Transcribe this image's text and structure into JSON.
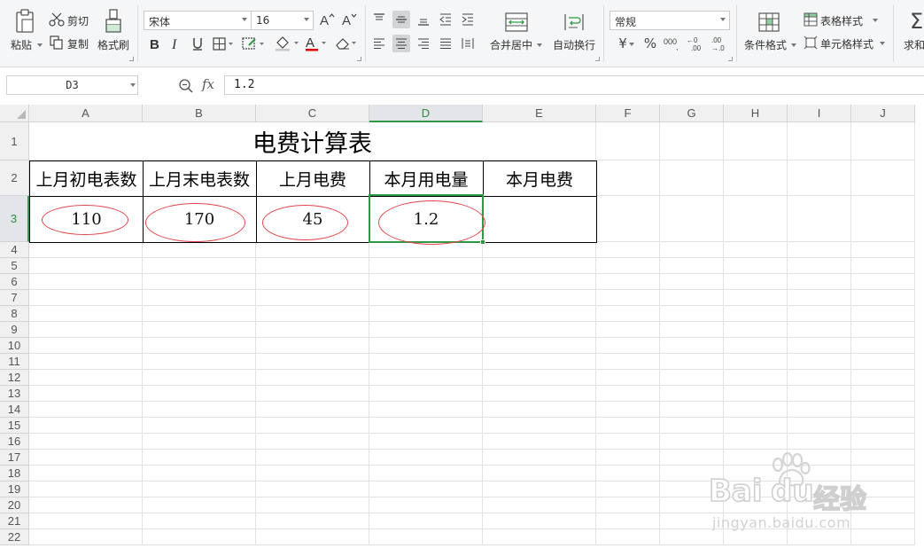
{
  "ribbon": {
    "clipboard": {
      "paste_label": "粘贴",
      "cut_label": "剪切",
      "copy_label": "复制",
      "format_painter_label": "格式刷"
    },
    "font": {
      "name": "宋体",
      "size": "16",
      "font_color": "#e0000b"
    },
    "alignment": {
      "merge_center_label": "合并居中",
      "wrap_text_label": "自动换行"
    },
    "number": {
      "format": "常规",
      "currency_symbol": "¥",
      "percent_symbol": "%"
    },
    "styles": {
      "conditional_format_label": "条件格式",
      "table_style_label": "表格样式",
      "cell_style_label": "单元格样式",
      "sum_label": "求和"
    }
  },
  "formula_bar": {
    "name_box": "D3",
    "fx_label": "fx",
    "content": "1.2"
  },
  "grid": {
    "columns": [
      "A",
      "B",
      "C",
      "D",
      "E",
      "F",
      "G",
      "H",
      "I",
      "J"
    ],
    "selected_column": "D",
    "row_numbers": [
      "1",
      "2",
      "3",
      "4",
      "5",
      "6",
      "7",
      "8",
      "9",
      "10",
      "11",
      "12",
      "13",
      "14",
      "15",
      "16",
      "17",
      "18",
      "19",
      "20",
      "21",
      "22"
    ],
    "selected_row": "3",
    "selection_color": "#2e9a46",
    "annotation_color": "#e3454b"
  },
  "sheet": {
    "title": "电费计算表",
    "headers": [
      "上月初电表数",
      "上月末电表数",
      "上月电费",
      "本月用电量",
      "本月电费"
    ],
    "values": [
      "110",
      "170",
      "45",
      "1.2",
      ""
    ],
    "active_cell": "D3"
  },
  "watermark": {
    "brand": "Bai",
    "brand_tail": "经验",
    "url": "jingyan.baidu.com"
  }
}
